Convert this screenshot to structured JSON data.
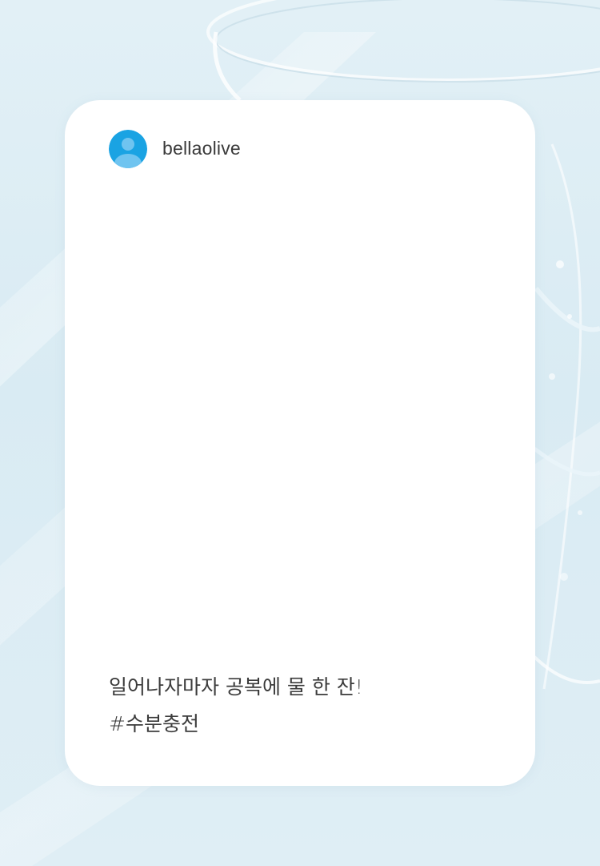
{
  "post": {
    "username": "bellaolive",
    "avatar_icon": "default-user-icon",
    "avatar_color": "#1aa3e3",
    "caption_line1": "일어나자마자 공복에 물 한 잔!",
    "caption_hashtag": "#수분충전"
  },
  "colors": {
    "background": "#dcedf4",
    "card": "#ffffff",
    "text": "#3b3b3b"
  }
}
